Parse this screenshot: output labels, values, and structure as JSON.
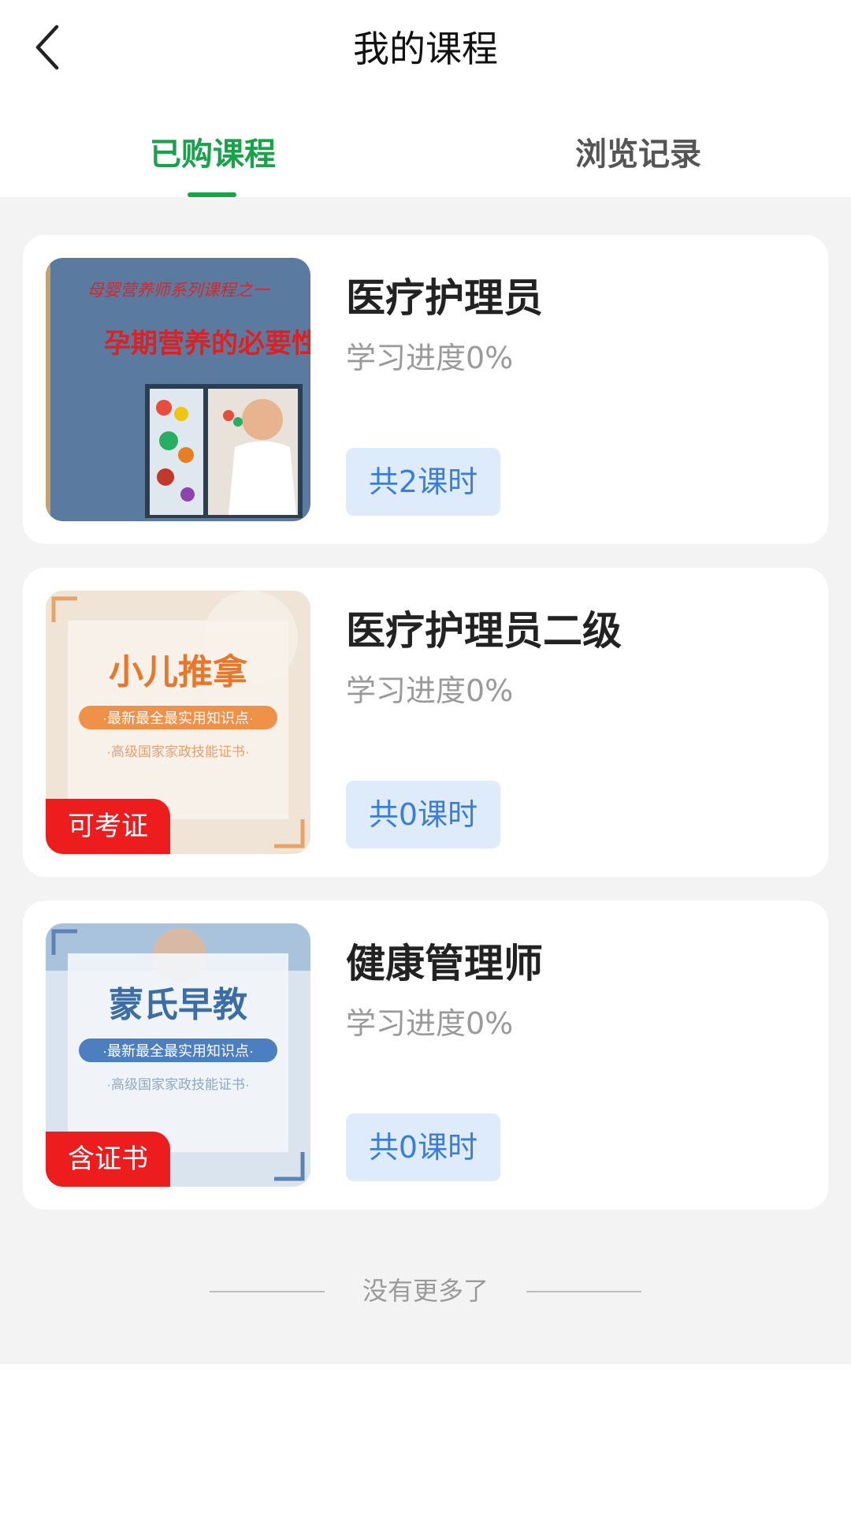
{
  "header": {
    "title": "我的课程",
    "back_icon": "chevron-left-icon"
  },
  "tabs": [
    {
      "label": "已购课程",
      "active": true
    },
    {
      "label": "浏览记录",
      "active": false
    }
  ],
  "colors": {
    "accent": "#17a34a",
    "badge_red": "#ee1d1d",
    "chip_bg": "#ddebfb",
    "chip_text": "#3a7ed8"
  },
  "courses": [
    {
      "title": "医疗护理员",
      "progress": "学习进度0%",
      "lessons": "共2课时",
      "thumb": {
        "top_text": "母婴营养师系列课程之一",
        "main_text": "孕期营养的必要性",
        "badge": ""
      }
    },
    {
      "title": "医疗护理员二级",
      "progress": "学习进度0%",
      "lessons": "共0课时",
      "thumb": {
        "main_text": "小儿推拿",
        "sub_text": "·最新最全最实用知识点·",
        "note_text": "·高级国家家政技能证书·",
        "badge": "可考证"
      }
    },
    {
      "title": "健康管理师",
      "progress": "学习进度0%",
      "lessons": "共0课时",
      "thumb": {
        "main_text": "蒙氏早教",
        "sub_text": "·最新最全最实用知识点·",
        "note_text": "·高级国家家政技能证书·",
        "badge": "含证书"
      }
    }
  ],
  "footer": {
    "text": "没有更多了"
  }
}
